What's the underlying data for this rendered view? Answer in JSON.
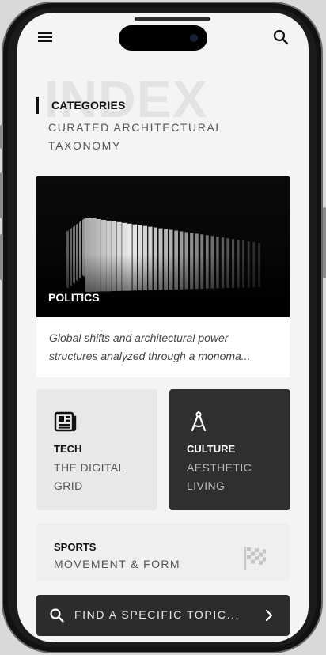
{
  "header": {
    "menu_icon": "hamburger-menu-icon",
    "search_icon": "search-icon",
    "watermark": "INDEX"
  },
  "categories": {
    "title": "CATEGORIES",
    "subtitle": "CURATED ARCHITECTURAL TAXONOMY"
  },
  "featured": {
    "tag": "POLITICS",
    "description": "Global shifts and architectural power structures analyzed through a monoma..."
  },
  "cards": {
    "tech": {
      "title": "TECH",
      "subtitle": "THE DIGITAL GRID",
      "icon": "newspaper-icon"
    },
    "culture": {
      "title": "CULTURE",
      "subtitle": "AESTHETIC LIVING",
      "icon": "compass-drafting-icon"
    }
  },
  "sports": {
    "title": "SPORTS",
    "subtitle": "MOVEMENT & FORM",
    "icon": "checkered-flag-icon"
  },
  "search_bar": {
    "label": "FIND A SPECIFIC TOPIC...",
    "icon": "search-icon",
    "chevron": "chevron-right-icon"
  },
  "colors": {
    "screen_bg": "#f4f4f4",
    "dark_card": "#2f2f2f",
    "light_card": "#e8e8e8",
    "search_bar": "#2c2c2c",
    "text_primary": "#111111"
  }
}
